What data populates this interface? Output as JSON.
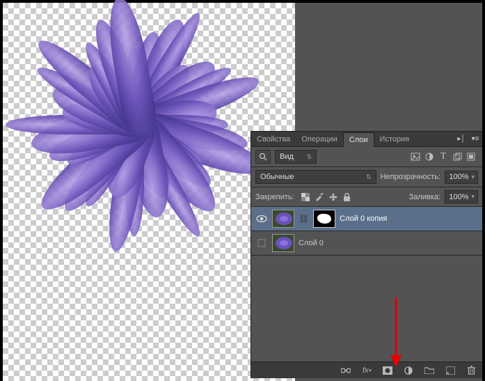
{
  "tabs": {
    "items": [
      {
        "label": "Свойства",
        "active": false
      },
      {
        "label": "Операции",
        "active": false
      },
      {
        "label": "Слои",
        "active": true
      },
      {
        "label": "История",
        "active": false
      }
    ]
  },
  "search": {
    "placeholder": "Вид"
  },
  "filterIcons": [
    "image-icon",
    "adjust-icon",
    "type-icon",
    "shape-icon",
    "smart-icon"
  ],
  "blend": {
    "mode": "Обычные",
    "opacityLabel": "Непрозрачность:",
    "opacityValue": "100%"
  },
  "lock": {
    "label": "Закрепить:",
    "fillLabel": "Заливка:",
    "fillValue": "100%"
  },
  "layers": [
    {
      "name": "Слой 0 копия",
      "visible": true,
      "selected": true,
      "hasMask": true
    },
    {
      "name": "Слой 0",
      "visible": false,
      "selected": false,
      "hasMask": false
    }
  ],
  "footerIcons": [
    "link-icon",
    "fx-icon",
    "mask-icon",
    "adjustment-icon",
    "group-icon",
    "new-layer-icon",
    "trash-icon"
  ]
}
